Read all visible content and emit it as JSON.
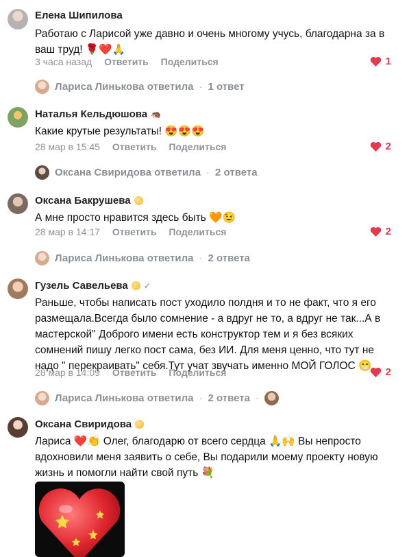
{
  "comments": [
    {
      "author": "Елена Шипилова",
      "text": "Работаю с Ларисой уже давно и очень многому учусь, благодарна за в ваш труд!",
      "time": "3 часа назад",
      "reply_label": "Ответить",
      "share_label": "Поделиться",
      "likes": "1",
      "replied_by": "Лариса Линькова ответила",
      "replies_count": "1 ответ"
    },
    {
      "author": "Наталья Кельдюшова",
      "text": "Какие крутые результаты!",
      "time": "28 мар в 15:45",
      "reply_label": "Ответить",
      "share_label": "Поделиться",
      "likes": "2",
      "replied_by": "Оксана Свиридова ответила",
      "replies_count": "2 ответа"
    },
    {
      "author": "Оксана Бакрушева",
      "text": "А мне просто нравится здесь быть",
      "time": "28 мар в 14:17",
      "reply_label": "Ответить",
      "share_label": "Поделиться",
      "likes": "2",
      "replied_by": "Лариса Линькова ответила",
      "replies_count": "2 ответа"
    },
    {
      "author": "Гузель Савельева",
      "text": "Раньше, чтобы написать пост уходило полдня и то не факт, что я его размещала.Всегда было сомнение - а вдруг не то, а вдруг не так...А в мастерской\" Доброго имени есть конструктор тем и я без всяких сомнений пишу легко пост сама, без ИИ. Для меня ценно, что тут не надо \" перекраивать\" себя.Тут учат звучать именно МОЙ ГОЛОС",
      "time": "28 мар в 14:09",
      "reply_label": "Ответить",
      "share_label": "Поделиться",
      "likes": "2",
      "replied_by": "Лариса Линькова ответила",
      "replies_count": "2 ответа"
    },
    {
      "author": "Оксана Свиридова",
      "text_parts": [
        "Лариса",
        "Олег, благодарю от всего сердца",
        "Вы непросто вдохновили меня заявить о себе, Вы подарили моему проекту новую жизнь и помогли найти свой путь"
      ]
    }
  ]
}
